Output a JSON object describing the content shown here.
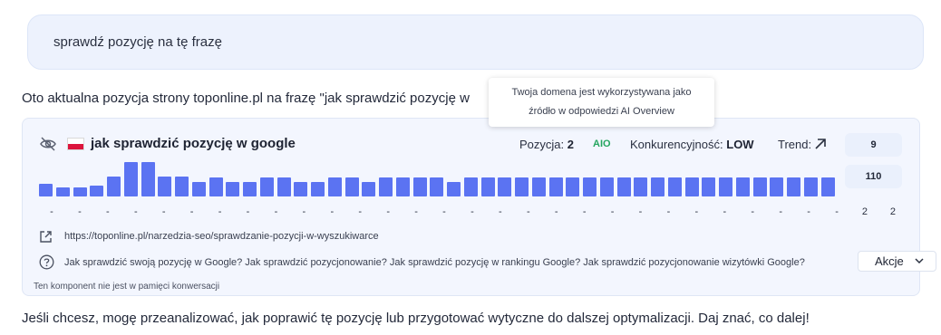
{
  "user_message": "sprawdź pozycję na tę frazę",
  "reply_intro": "Oto aktualna pozycja strony toponline.pl na frazę \"jak sprawdzić pozycję w",
  "tooltip": {
    "line1": "Twoja domena jest wykorzystywana jako",
    "line2": "źródło w odpowiedzi AI Overview"
  },
  "card": {
    "keyword": "jak sprawdzić pozycję w google",
    "position_label": "Pozycja:",
    "position_value": "2",
    "aio_badge": "AIO",
    "competition_label": "Konkurencyjność:",
    "competition_value": "LOW",
    "trend_label": "Trend:",
    "trend_icon": "arrow-up-right-icon",
    "search_volume_top": "9",
    "search_volume_bottom": "110",
    "history_levels": [
      0.34,
      0.26,
      0.26,
      0.31,
      0.56,
      0.95,
      0.95,
      0.56,
      0.56,
      0.39,
      0.52,
      0.39,
      0.39,
      0.52,
      0.52,
      0.39,
      0.39,
      0.52,
      0.52,
      0.39,
      0.52,
      0.52,
      0.52,
      0.52,
      0.39,
      0.52,
      0.52,
      0.52,
      0.52,
      0.52,
      0.52,
      0.52,
      0.52,
      0.52,
      0.52,
      0.52,
      0.52,
      0.52,
      0.52,
      0.52,
      0.52,
      0.52,
      0.52,
      0.52,
      0.52,
      0.52,
      0.52
    ],
    "ticks": [
      "-",
      "-",
      "-",
      "-",
      "-",
      "-",
      "-",
      "-",
      "-",
      "-",
      "-",
      "-",
      "-",
      "-",
      "-",
      "-",
      "-",
      "-",
      "-",
      "-",
      "-",
      "-",
      "-",
      "-",
      "-",
      "-",
      "-",
      "-",
      "-",
      "2",
      "2"
    ],
    "url": "https://toponline.pl/narzedzia-seo/sprawdzanie-pozycji-w-wyszukiwarce",
    "questions": "Jak sprawdzić swoją pozycję w Google? Jak sprawdzić pozycjonowanie? Jak sprawdzić pozycję w rankingu Google? Jak sprawdzić pozycjonowanie wizytówki Google?",
    "actions_label": "Akcje",
    "memory_note": "Ten komponent nie jest w pamięci konwersacji"
  },
  "outro": "Jeśli chcesz, mogę przeanalizować, jak poprawić tę pozycję lub przygotować wytyczne do dalszej optymalizacji. Daj znać, co dalej!",
  "colors": {
    "accent": "#5b73f2",
    "aio": "#25a55f",
    "bubble": "#edf2fd",
    "card": "#f3f6fe"
  }
}
